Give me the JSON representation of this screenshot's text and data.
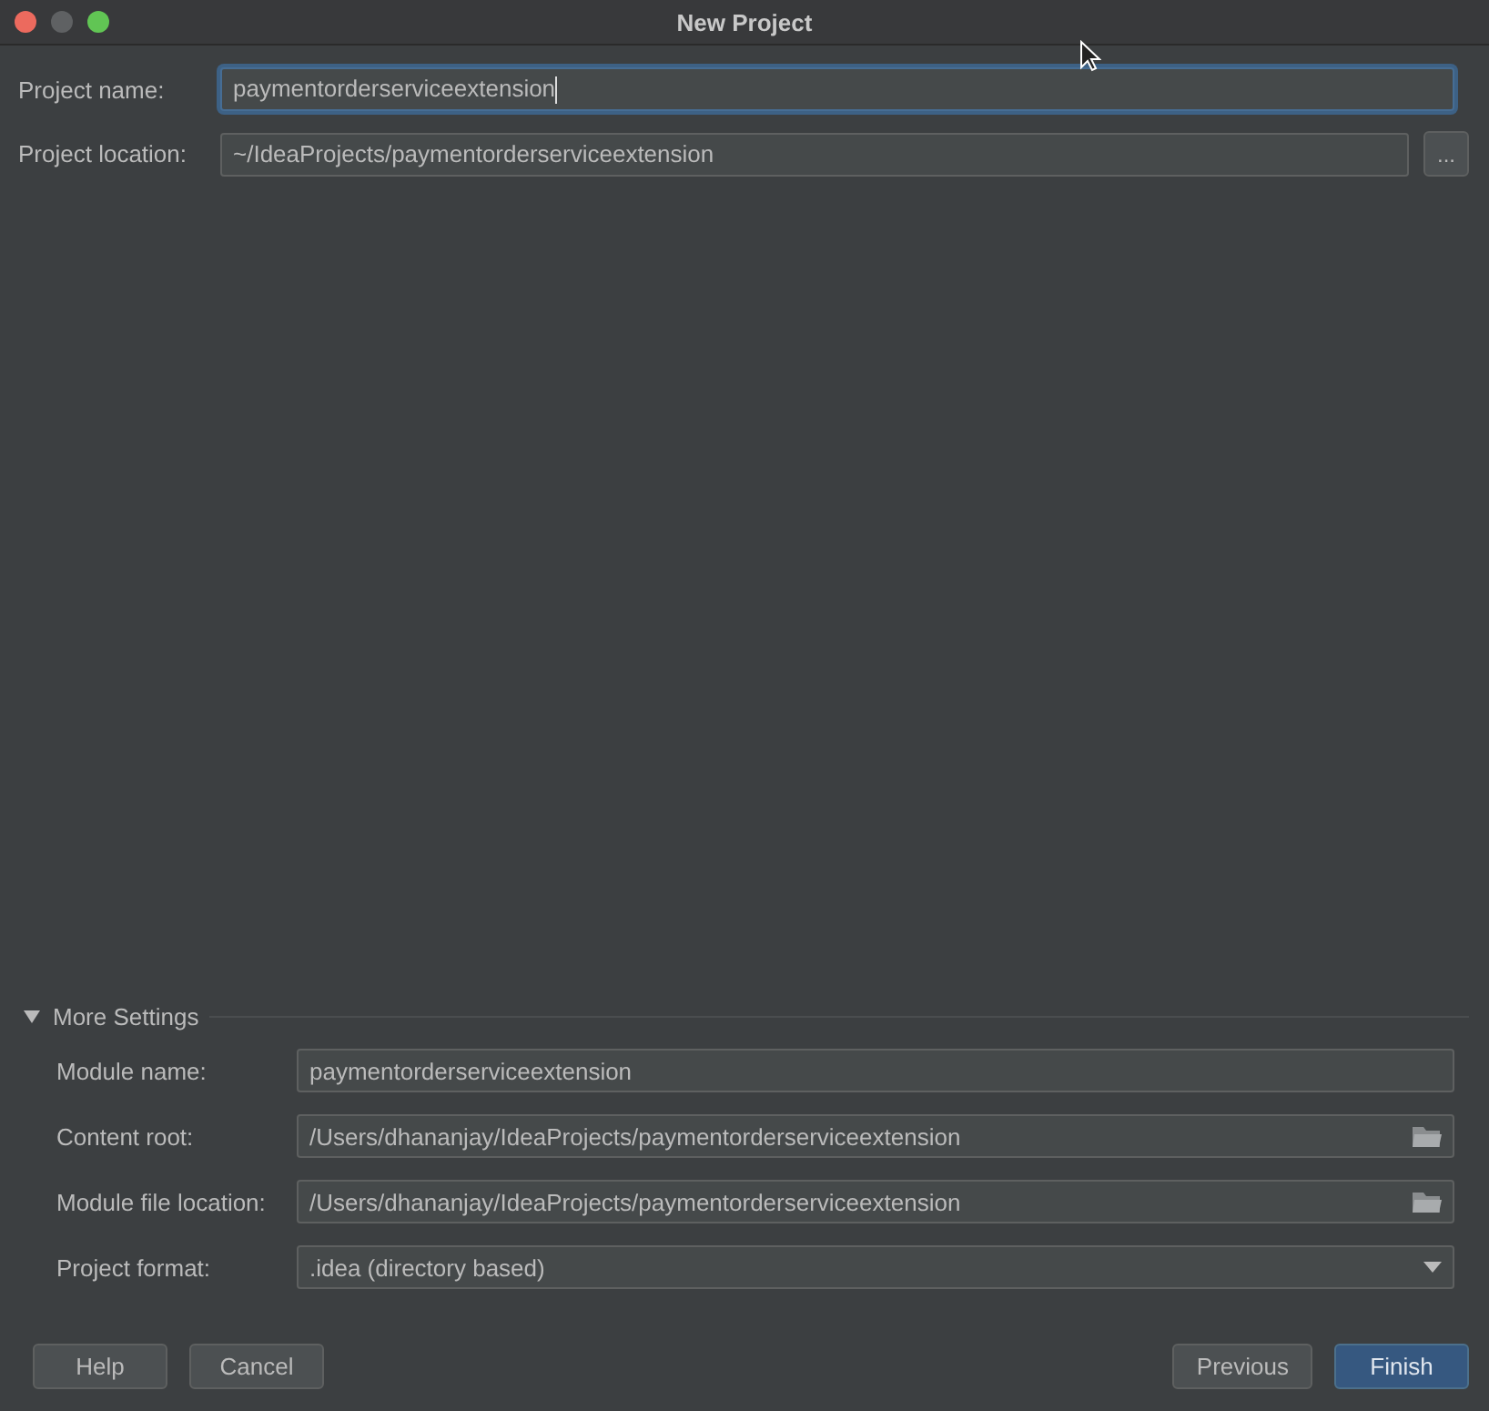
{
  "window": {
    "title": "New Project"
  },
  "fields": [
    {
      "label": "Project name:",
      "value": "paymentorderserviceextension",
      "focused": true
    },
    {
      "label": "Project location:",
      "value": "~/IdeaProjects/paymentorderserviceextension",
      "focused": false,
      "browse_button": "..."
    }
  ],
  "more_settings": {
    "label": "More Settings",
    "expanded": true,
    "fields": [
      {
        "kind": "text",
        "label": "Module name:",
        "value": "paymentorderserviceextension"
      },
      {
        "kind": "folder",
        "label": "Content root:",
        "value": "/Users/dhananjay/IdeaProjects/paymentorderserviceextension"
      },
      {
        "kind": "folder",
        "label": "Module file location:",
        "value": "/Users/dhananjay/IdeaProjects/paymentorderserviceextension"
      },
      {
        "kind": "select",
        "label": "Project format:",
        "value": ".idea (directory based)"
      }
    ]
  },
  "buttons_left": [
    {
      "label": "Help",
      "default": false
    },
    {
      "label": "Cancel",
      "default": false
    }
  ],
  "buttons_right": [
    {
      "label": "Previous",
      "default": false
    },
    {
      "label": "Finish",
      "default": true
    }
  ]
}
